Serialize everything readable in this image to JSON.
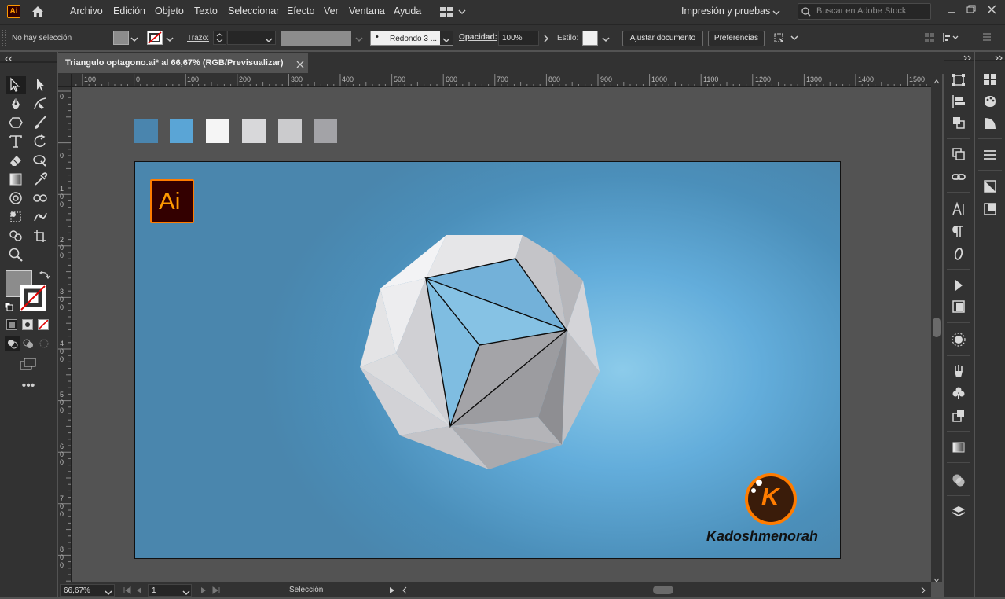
{
  "app": {
    "logo_text": "Ai"
  },
  "menubar": {
    "items": [
      "Archivo",
      "Edición",
      "Objeto",
      "Texto",
      "Seleccionar",
      "Efecto",
      "Ver",
      "Ventana",
      "Ayuda"
    ],
    "workspace": "Impresión y pruebas",
    "stock_search_placeholder": "Buscar en Adobe Stock"
  },
  "control_bar": {
    "selection_status": "No hay selección",
    "stroke_label": "Trazo:",
    "brush_label": "Redondo 3 ...",
    "opacity_label": "Opacidad:",
    "opacity_value": "100%",
    "style_label": "Estilo:",
    "adjust_document_button": "Ajustar documento",
    "preferences_button": "Preferencias"
  },
  "document_tab": {
    "title": "Triangulo  optagono.ai* al 66,67% (RGB/Previsualizar)"
  },
  "ruler": {
    "h_labels": [
      "100",
      "0",
      "100",
      "200",
      "300",
      "400",
      "500",
      "600",
      "700",
      "800",
      "900",
      "1000",
      "1100",
      "1200",
      "1300",
      "1400",
      "1500"
    ],
    "v_labels": [
      "0",
      "0",
      "1 0 0",
      "2 0 0",
      "3 0 0",
      "4 0 0",
      "5 0 0",
      "6 0 0",
      "7 0 0",
      "8 0 0"
    ]
  },
  "swatches": [
    {
      "name": "swatch-dark-blue",
      "color": "#4a85ae"
    },
    {
      "name": "swatch-light-blue",
      "color": "#5aa5d6"
    },
    {
      "name": "swatch-white",
      "color": "#f5f5f5"
    },
    {
      "name": "swatch-light-gray",
      "color": "#d8d8da"
    },
    {
      "name": "swatch-gray",
      "color": "#cbcbcd"
    },
    {
      "name": "swatch-dark-gray",
      "color": "#a3a3a7"
    }
  ],
  "artwork": {
    "ai_badge_text": "Ai",
    "brand_letter": "K",
    "brand_name": "Kadoshmenorah",
    "accent_color": "#ff7c00",
    "bg_color_center": "#8ccbea",
    "bg_color_edge": "#4a86ad"
  },
  "status_bar": {
    "zoom": "66,67%",
    "artboard_number": "1",
    "tool_status": "Selección"
  }
}
